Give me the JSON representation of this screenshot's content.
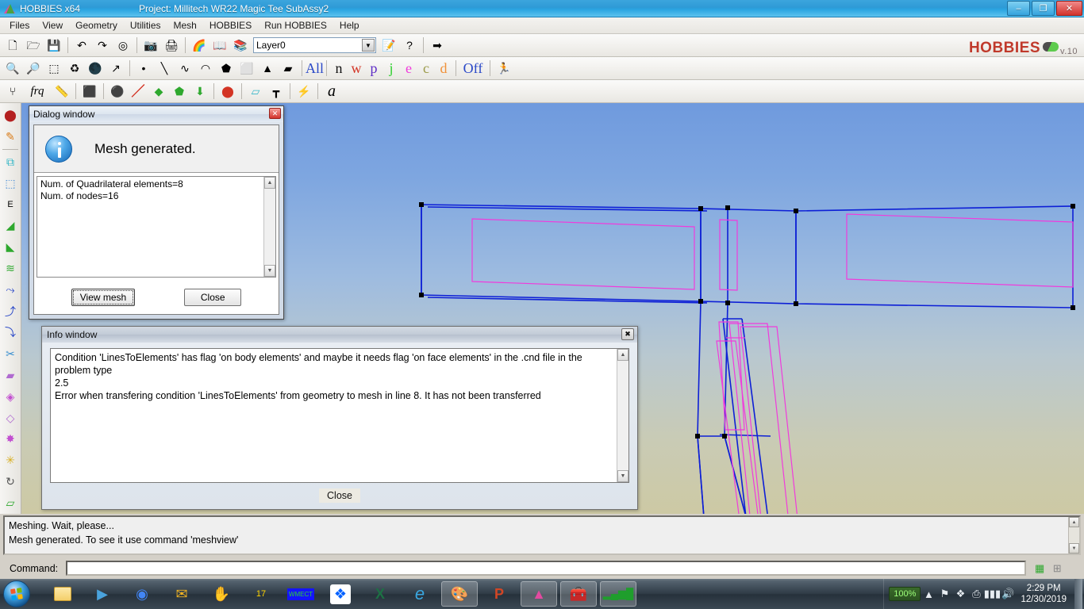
{
  "titlebar": {
    "app_title": "HOBBIES x64",
    "project_title": "Project: Millitech WR22 Magic Tee SubAssy2",
    "minimize": "–",
    "maximize": "❐",
    "close": "✕"
  },
  "menubar": {
    "items": [
      {
        "label": "Files"
      },
      {
        "label": "View"
      },
      {
        "label": "Geometry"
      },
      {
        "label": "Utilities"
      },
      {
        "label": "Mesh"
      },
      {
        "label": "HOBBIES"
      },
      {
        "label": "Run HOBBIES"
      },
      {
        "label": "Help"
      }
    ]
  },
  "brand": {
    "name": "HOBBIES",
    "version": "v.10"
  },
  "toolbar_row1": {
    "layer_value": "Layer0",
    "dropdown_arrow": "▼",
    "tools": [
      {
        "name": "new-file-icon",
        "glyph": "🗋"
      },
      {
        "name": "open-file-icon",
        "glyph": "🗁"
      },
      {
        "name": "save-file-icon",
        "glyph": "💾"
      },
      {
        "name": "undo-view-icon",
        "glyph": "↶"
      },
      {
        "name": "redo-view-icon",
        "glyph": "↷"
      },
      {
        "name": "view-options-icon",
        "glyph": "◎"
      },
      {
        "name": "snapshot-icon",
        "glyph": "📷"
      },
      {
        "name": "print-icon",
        "glyph": "🖨"
      },
      {
        "name": "render-icon",
        "glyph": "🌈"
      },
      {
        "name": "book-icon",
        "glyph": "📖"
      },
      {
        "name": "layers-icon",
        "glyph": "📚"
      },
      {
        "name": "edit-note-icon",
        "glyph": "📝"
      },
      {
        "name": "help-icon",
        "glyph": "?"
      },
      {
        "name": "exit-icon",
        "glyph": "➡"
      }
    ]
  },
  "toolbar_row2": {
    "tools": [
      {
        "name": "zoom-in-icon",
        "glyph": "🔍"
      },
      {
        "name": "zoom-out-icon",
        "glyph": "🔎"
      },
      {
        "name": "zoom-frame-icon",
        "glyph": "⬚"
      },
      {
        "name": "redraw-icon",
        "glyph": "♻"
      },
      {
        "name": "render-shade-icon",
        "glyph": "🌑"
      },
      {
        "name": "rotate-icon",
        "glyph": "↗"
      },
      {
        "name": "point-entity-icon",
        "glyph": "•"
      },
      {
        "name": "line-entity-icon",
        "glyph": "╲"
      },
      {
        "name": "polyline-entity-icon",
        "glyph": "∿"
      },
      {
        "name": "arc-entity-icon",
        "glyph": "◠"
      },
      {
        "name": "surface-entity-icon",
        "glyph": "⬟"
      },
      {
        "name": "volume-entity-icon",
        "glyph": "⬜"
      },
      {
        "name": "cone-entity-icon",
        "glyph": "▲"
      },
      {
        "name": "eraser-icon",
        "glyph": "▰"
      }
    ],
    "selectors": [
      {
        "name": "select-all",
        "label": "All",
        "color": "#2b49c8"
      },
      {
        "name": "select-n",
        "label": "n",
        "color": "#111111"
      },
      {
        "name": "select-w",
        "label": "w",
        "color": "#d33424"
      },
      {
        "name": "select-p",
        "label": "p",
        "color": "#5d2cc6"
      },
      {
        "name": "select-j",
        "label": "j",
        "color": "#2fd02f"
      },
      {
        "name": "select-e",
        "label": "e",
        "color": "#f03bdc"
      },
      {
        "name": "select-c",
        "label": "c",
        "color": "#9b9b4a"
      },
      {
        "name": "select-d",
        "label": "d",
        "color": "#f0923a"
      },
      {
        "name": "select-off",
        "label": "Off",
        "color": "#2b49c8"
      }
    ],
    "run_icon": {
      "name": "run-icon",
      "glyph": "🏃"
    }
  },
  "toolbar_row3": {
    "tools": [
      {
        "name": "antenna-icon",
        "glyph": "⑂"
      },
      {
        "name": "frequency-icon",
        "glyph": "frq"
      },
      {
        "name": "ruler-icon",
        "glyph": "📏"
      },
      {
        "name": "materials-icon",
        "glyph": "⬛"
      },
      {
        "name": "node-icon",
        "glyph": "⚫"
      },
      {
        "name": "line-mesh-icon",
        "glyph": "／"
      },
      {
        "name": "surface-mesh-icon",
        "glyph": "◆"
      },
      {
        "name": "volume-mesh-icon",
        "glyph": "⬟"
      },
      {
        "name": "mesh-arrow-icon",
        "glyph": "⬇"
      },
      {
        "name": "sphere-cube-icon",
        "glyph": "⬤"
      },
      {
        "name": "plate-icon",
        "glyph": "▱"
      },
      {
        "name": "gap-icon",
        "glyph": "┳"
      },
      {
        "name": "excite-icon",
        "glyph": "⚡"
      },
      {
        "name": "annotate-icon",
        "glyph": "a"
      }
    ]
  },
  "leftbar": {
    "tools": [
      {
        "name": "point-create-icon",
        "glyph": "⬤"
      },
      {
        "name": "edit-geometry-icon",
        "glyph": "✎"
      },
      {
        "name": "copy-entity-icon",
        "glyph": "⧉"
      },
      {
        "name": "select-region-icon",
        "glyph": "⬚"
      },
      {
        "name": "dimension-icon",
        "glyph": "E"
      },
      {
        "name": "surface-create-icon",
        "glyph": "◢"
      },
      {
        "name": "surface-nurbs-icon",
        "glyph": "◣"
      },
      {
        "name": "contour-icon",
        "glyph": "≋"
      },
      {
        "name": "move-point-icon",
        "glyph": "⤳"
      },
      {
        "name": "curve-edit-icon",
        "glyph": "⤴"
      },
      {
        "name": "curve-point-icon",
        "glyph": "⤵"
      },
      {
        "name": "intersect-cut-icon",
        "glyph": "✂"
      },
      {
        "name": "split-surface-icon",
        "glyph": "▰"
      },
      {
        "name": "nurbs-surface-icon",
        "glyph": "◈"
      },
      {
        "name": "trim-surface-icon",
        "glyph": "◇"
      },
      {
        "name": "collapse-icon",
        "glyph": "✸"
      },
      {
        "name": "burst-icon",
        "glyph": "✳"
      },
      {
        "name": "transform-icon",
        "glyph": "↻"
      },
      {
        "name": "layers-stack-icon",
        "glyph": "▱"
      }
    ]
  },
  "dialog": {
    "title": "Dialog window",
    "close_glyph": "✕",
    "icon_name": "information-icon",
    "message": "Mesh generated.",
    "details": [
      "Num. of Quadrilateral elements=8",
      "Num. of nodes=16"
    ],
    "scroll_up": "▲",
    "scroll_down": "▼",
    "buttons": {
      "view_mesh": "View mesh",
      "close": "Close"
    }
  },
  "info_window": {
    "title": "Info window",
    "close_glyph": "✖",
    "lines": [
      "Condition 'LinesToElements' has flag 'on body elements' and maybe it needs flag 'on face elements' in the .cnd file in the",
      "problem type",
      "2.5",
      "Error when transfering condition 'LinesToElements' from geometry to mesh in line 8. It has not been transferred"
    ],
    "scroll_up": "▲",
    "scroll_down": "▼",
    "close_button": "Close"
  },
  "status_bar": {
    "lines": [
      "Meshing. Wait, please...",
      "Mesh generated. To see it use command 'meshview'"
    ],
    "scroll_up": "▲",
    "scroll_down": "▼"
  },
  "command_bar": {
    "label": "Command:",
    "value": "",
    "placeholder": "",
    "icons": [
      {
        "name": "chip-icon",
        "glyph": "▦"
      },
      {
        "name": "grid-icon",
        "glyph": "⊞"
      }
    ]
  },
  "taskbar": {
    "start_name": "start-orb",
    "items": [
      {
        "name": "taskbar-windows-explorer",
        "glyph": "🗂",
        "active": false
      },
      {
        "name": "taskbar-media-player",
        "glyph": "▶",
        "active": false
      },
      {
        "name": "taskbar-google-chrome",
        "glyph": "◉",
        "active": false
      },
      {
        "name": "taskbar-outlook",
        "glyph": "✉",
        "active": false
      },
      {
        "name": "taskbar-app-red",
        "glyph": "✋",
        "active": false
      },
      {
        "name": "taskbar-labview",
        "glyph": "17",
        "active": false
      },
      {
        "name": "taskbar-wmect",
        "glyph": "WMECT",
        "active": false
      },
      {
        "name": "taskbar-dropbox",
        "glyph": "❖",
        "active": false
      },
      {
        "name": "taskbar-excel",
        "glyph": "X",
        "active": false
      },
      {
        "name": "taskbar-internet-explorer",
        "glyph": "e",
        "active": false
      },
      {
        "name": "taskbar-paint",
        "glyph": "🎨",
        "active": true
      },
      {
        "name": "taskbar-powerpoint",
        "glyph": "P",
        "active": false
      },
      {
        "name": "taskbar-hobbies-gid",
        "glyph": "▲",
        "active": true
      },
      {
        "name": "taskbar-toolbox-error",
        "glyph": "🧰",
        "active": true
      },
      {
        "name": "taskbar-signal-chart",
        "glyph": "▂▄▆█",
        "active": true
      }
    ],
    "tray": {
      "hidden_icons": "▲",
      "flag_icon": "⚑",
      "dropbox_icon": "❖",
      "usb_icon": "⎙",
      "network_icon": "▮▮▮",
      "volume_icon": "🔊",
      "battery_icon": "■",
      "zoom_level": "100%",
      "time": "2:29 PM",
      "date": "12/30/2019"
    }
  },
  "canvas": {
    "name": "geometry-3d-viewport",
    "description": "Wireframe 3D view of WR22 magic tee waveguide sub-assembly",
    "colors": {
      "outer_edges": "#0d1fd6",
      "inner_edges": "#f03bdc",
      "nodes": "#000000"
    }
  }
}
